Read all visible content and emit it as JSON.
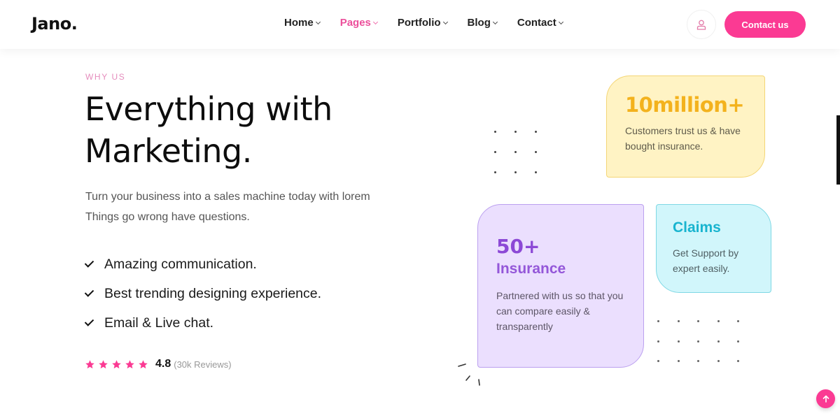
{
  "header": {
    "logo": "Jano.",
    "nav": [
      {
        "label": "Home",
        "active": false
      },
      {
        "label": "Pages",
        "active": true
      },
      {
        "label": "Portfolio",
        "active": false
      },
      {
        "label": "Blog",
        "active": false
      },
      {
        "label": "Contact",
        "active": false
      }
    ],
    "user_icon": "user-icon",
    "cta_label": "Contact us"
  },
  "hero": {
    "eyebrow": "WHY US",
    "title_line1": "Everything with",
    "title_line2": "Marketing.",
    "description_line1": "Turn your business into a sales machine today with lorem",
    "description_line2": "Things go wrong have questions.",
    "features": [
      "Amazing communication.",
      "Best trending designing experience.",
      "Email & Live chat."
    ],
    "rating": {
      "stars": 5,
      "value": "4.8",
      "count": "(30k Reviews)"
    }
  },
  "cards": {
    "customers": {
      "stat": "10million+",
      "text": "Customers trust us & have bought insurance."
    },
    "insurance": {
      "stat": "50+",
      "subtitle": "Insurance",
      "text": "Partnered with us so that you can compare easily & transparently"
    },
    "claims": {
      "title": "Claims",
      "text": "Get Support by expert easily."
    }
  },
  "colors": {
    "accent": "#fb3a93",
    "nav_active": "#ec4f9b",
    "yellow_card": "#fff3c4",
    "purple_card": "#ebdffe",
    "cyan_card": "#d1f6fb"
  },
  "back_to_top_icon": "arrow-up-icon"
}
